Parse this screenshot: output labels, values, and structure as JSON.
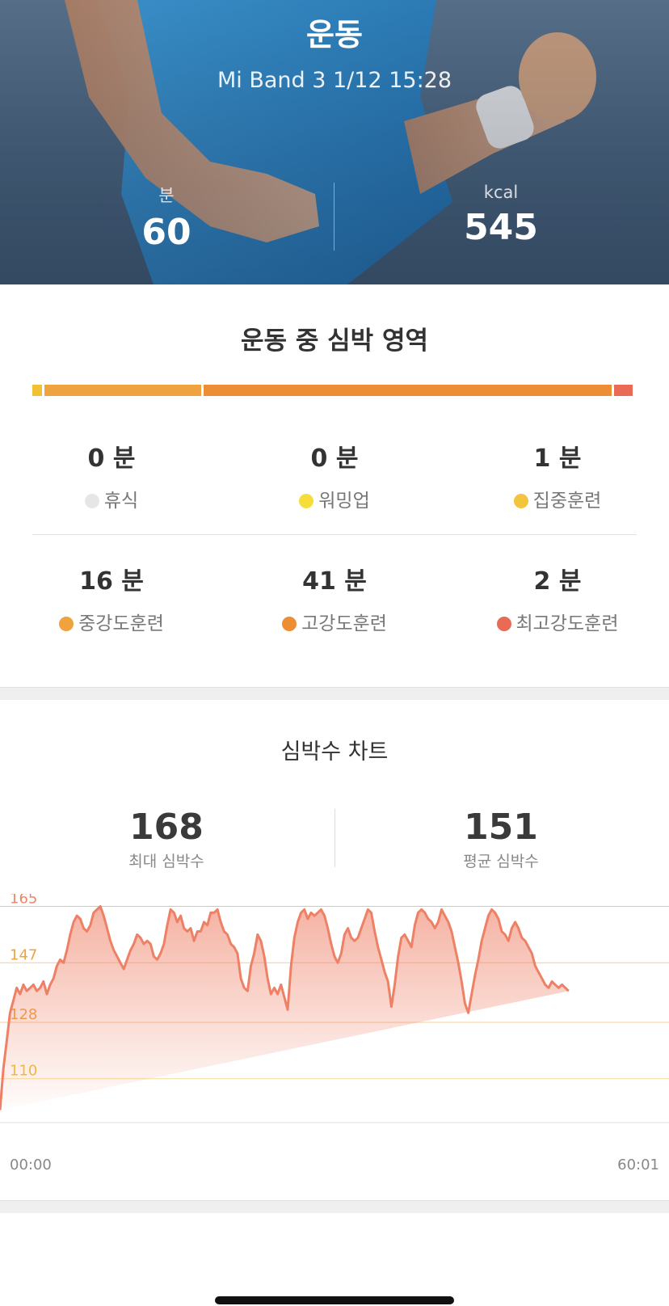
{
  "header": {
    "title": "운동",
    "subtitle": "Mi Band 3 1/12 15:28",
    "duration": {
      "label": "분",
      "value": "60"
    },
    "calories": {
      "label": "kcal",
      "value": "545"
    }
  },
  "zones": {
    "title": "운동 중 심박 영역",
    "bar_colors": [
      "#f2c035",
      "#f0a23e",
      "#ee8e34",
      "#e96b55"
    ],
    "items": [
      {
        "minutes": "0 분",
        "name": "휴식",
        "color": "#e6e6e6"
      },
      {
        "minutes": "0 분",
        "name": "워밍업",
        "color": "#f6de3a"
      },
      {
        "minutes": "1 분",
        "name": "집중훈련",
        "color": "#f3c53c"
      },
      {
        "minutes": "16 분",
        "name": "중강도훈련",
        "color": "#f0a23e"
      },
      {
        "minutes": "41 분",
        "name": "고강도훈련",
        "color": "#ee8e34"
      },
      {
        "minutes": "2 분",
        "name": "최고강도훈련",
        "color": "#e96b55"
      }
    ]
  },
  "heart_rate": {
    "title": "심박수 차트",
    "max": {
      "value": "168",
      "label": "최대 심박수"
    },
    "avg": {
      "value": "151",
      "label": "평균 심박수"
    },
    "x_start": "00:00",
    "x_end": "60:01"
  },
  "chart_data": {
    "type": "area",
    "xlabel": "",
    "ylabel": "",
    "x_range": [
      0,
      60
    ],
    "ylim": [
      96,
      169
    ],
    "reference_lines": [
      {
        "value": 165,
        "label": "165",
        "color": "#e9876c"
      },
      {
        "value": 147,
        "label": "147",
        "color": "#f0a23e"
      },
      {
        "value": 128,
        "label": "128",
        "color": "#f0a23e"
      },
      {
        "value": 110,
        "label": "110",
        "color": "#f2c035"
      }
    ],
    "x": [
      0,
      0.3,
      0.6,
      0.9,
      1.2,
      1.5,
      1.8,
      2.1,
      2.4,
      2.7,
      3.0,
      3.3,
      3.6,
      3.9,
      4.2,
      4.5,
      4.8,
      5.1,
      5.4,
      5.7,
      6.0,
      6.3,
      6.6,
      6.9,
      7.2,
      7.5,
      7.8,
      8.1,
      8.4,
      8.7,
      9.0,
      9.3,
      9.6,
      9.9,
      10.2,
      10.5,
      10.8,
      11.1,
      11.4,
      11.7,
      12.0,
      12.3,
      12.6,
      12.9,
      13.2,
      13.5,
      13.8,
      14.1,
      14.4,
      14.7,
      15.0,
      15.3,
      15.6,
      15.9,
      16.2,
      16.5,
      16.8,
      17.1,
      17.4,
      17.7,
      18.0,
      18.3,
      18.6,
      18.9,
      19.2,
      19.5,
      19.8,
      20.1,
      20.4,
      20.7,
      21.0,
      21.3,
      21.6,
      21.9,
      22.2,
      22.5,
      22.8,
      23.1,
      23.4,
      23.7,
      24.0,
      24.3,
      24.6,
      24.9,
      25.2,
      25.5,
      25.8,
      26.1,
      26.4,
      26.7,
      27.0,
      27.3,
      27.6,
      27.9,
      28.2,
      28.5,
      28.8,
      29.1,
      29.4,
      29.7,
      30.0,
      30.3,
      30.6,
      30.9,
      31.2,
      31.5,
      31.8,
      32.1,
      32.4,
      32.7,
      33.0,
      33.3,
      33.6,
      33.9,
      34.2,
      34.5,
      34.8,
      35.1,
      35.4,
      35.7,
      36.0,
      36.3,
      36.6,
      36.9,
      37.2,
      37.5,
      37.8,
      38.1,
      38.4,
      38.7,
      39.0,
      39.3,
      39.6,
      39.9,
      40.2,
      40.5,
      40.8,
      41.1,
      41.4,
      41.7,
      42.0,
      42.3,
      42.6,
      42.9,
      43.2,
      43.5,
      43.8,
      44.1,
      44.4,
      44.7,
      45.0,
      45.3,
      45.6,
      45.9,
      46.2,
      46.5,
      46.8,
      47.1,
      47.4,
      47.7,
      48.0,
      48.3,
      48.6,
      48.9,
      49.2,
      49.5,
      49.8,
      50.1,
      50.4,
      50.7,
      51.0,
      51.3,
      51.6,
      51.9,
      52.2,
      52.5,
      52.8,
      53.1,
      53.4,
      53.7,
      54.0,
      54.3,
      54.6,
      54.9,
      55.2,
      55.5,
      55.8,
      56.1,
      56.4,
      56.7,
      57.0,
      57.3,
      57.6,
      57.9,
      58.2,
      58.5,
      58.8,
      59.1,
      59.4,
      59.7,
      60.0
    ],
    "series": [
      {
        "color": "#ee8066",
        "values": [
          100,
          113,
          122,
          131,
          135,
          139,
          137,
          140,
          138,
          139,
          140,
          138,
          139,
          141,
          137,
          140,
          142,
          146,
          148,
          147,
          151,
          156,
          160,
          162,
          161,
          158,
          157,
          159,
          163,
          164,
          165,
          162,
          158,
          154,
          151,
          149,
          147,
          145,
          148,
          151,
          153,
          156,
          155,
          153,
          154,
          153,
          149,
          148,
          150,
          153,
          159,
          164,
          163,
          160,
          162,
          158,
          157,
          158,
          154,
          157,
          157,
          160,
          159,
          163,
          163,
          164,
          160,
          157,
          156,
          153,
          152,
          150,
          142,
          139,
          138,
          146,
          150,
          156,
          154,
          149,
          142,
          137,
          139,
          137,
          140,
          136,
          132,
          146,
          155,
          160,
          163,
          164,
          161,
          163,
          162,
          163,
          164,
          162,
          158,
          153,
          149,
          147,
          150,
          156,
          158,
          155,
          154,
          155,
          158,
          161,
          164,
          163,
          157,
          152,
          148,
          144,
          141,
          133,
          140,
          149,
          155,
          156,
          154,
          152,
          159,
          163,
          164,
          163,
          161,
          160,
          158,
          160,
          164,
          162,
          160,
          157,
          152,
          147,
          141,
          134,
          131,
          137,
          143,
          148,
          154,
          158,
          162,
          164,
          163,
          161,
          157,
          156,
          154,
          158,
          160,
          158,
          155,
          154,
          152,
          150,
          146,
          144,
          142,
          140,
          139,
          141,
          140,
          139,
          140,
          139,
          138
        ]
      }
    ]
  }
}
